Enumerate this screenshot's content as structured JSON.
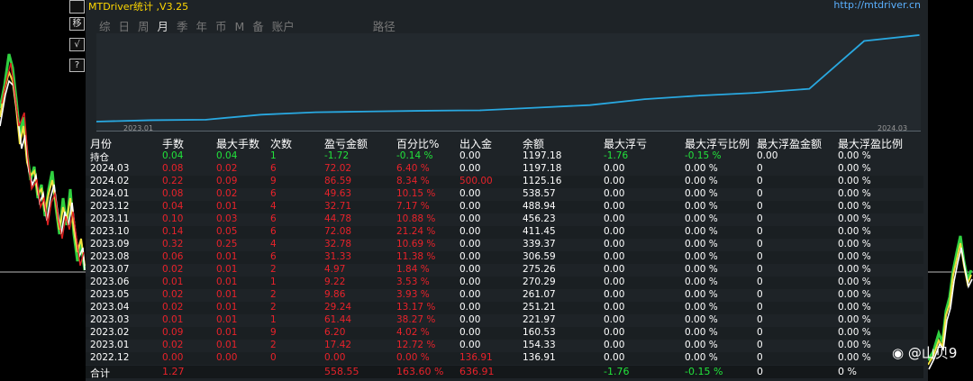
{
  "app": {
    "title": "MTDriver统计 ,V3.25",
    "url": "http://mtdriver.cn"
  },
  "side_buttons": [
    "移",
    "√",
    "?"
  ],
  "tabs": [
    {
      "label": "综",
      "active": false
    },
    {
      "label": "日",
      "active": false
    },
    {
      "label": "周",
      "active": false
    },
    {
      "label": "月",
      "active": true
    },
    {
      "label": "季",
      "active": false
    },
    {
      "label": "年",
      "active": false
    },
    {
      "label": "币",
      "active": false
    },
    {
      "label": "M",
      "active": false
    },
    {
      "label": "备",
      "active": false
    },
    {
      "label": "账户",
      "active": false
    }
  ],
  "path_label": "路径",
  "equity_chart": {
    "start_label": "2023.01",
    "end_label": "2024.03",
    "line_color": "#29a8e0",
    "balances": [
      136.91,
      154.33,
      160.53,
      221.97,
      251.21,
      261.07,
      270.29,
      275.26,
      306.59,
      339.37,
      411.45,
      456.23,
      488.94,
      538.57,
      1125.16,
      1197.18
    ]
  },
  "columns": [
    "月份",
    "手数",
    "最大手数",
    "次数",
    "盈亏金额",
    "百分比%",
    "出入金",
    "余额",
    "最大浮亏",
    "最大浮亏比例",
    "最大浮盈金额",
    "最大浮盈比例"
  ],
  "holding": [
    "持仓",
    "0.04",
    "0.04",
    "1",
    "-1.72",
    "-0.14 %",
    "0.00",
    "1197.18",
    "-1.76",
    "-0.15 %",
    "0.00",
    "0.00 %"
  ],
  "rows": [
    [
      "2024.03",
      "0.08",
      "0.02",
      "6",
      "72.02",
      "6.40 %",
      "0.00",
      "1197.18",
      "0.00",
      "0.00 %",
      "0",
      "0.00 %"
    ],
    [
      "2024.02",
      "0.22",
      "0.09",
      "9",
      "86.59",
      "8.34 %",
      "500.00",
      "1125.16",
      "0.00",
      "0.00 %",
      "0",
      "0.00 %"
    ],
    [
      "2024.01",
      "0.08",
      "0.02",
      "6",
      "49.63",
      "10.15 %",
      "0.00",
      "538.57",
      "0.00",
      "0.00 %",
      "0",
      "0.00 %"
    ],
    [
      "2023.12",
      "0.04",
      "0.01",
      "4",
      "32.71",
      "7.17 %",
      "0.00",
      "488.94",
      "0.00",
      "0.00 %",
      "0",
      "0.00 %"
    ],
    [
      "2023.11",
      "0.10",
      "0.03",
      "6",
      "44.78",
      "10.88 %",
      "0.00",
      "456.23",
      "0.00",
      "0.00 %",
      "0",
      "0.00 %"
    ],
    [
      "2023.10",
      "0.14",
      "0.05",
      "6",
      "72.08",
      "21.24 %",
      "0.00",
      "411.45",
      "0.00",
      "0.00 %",
      "0",
      "0.00 %"
    ],
    [
      "2023.09",
      "0.32",
      "0.25",
      "4",
      "32.78",
      "10.69 %",
      "0.00",
      "339.37",
      "0.00",
      "0.00 %",
      "0",
      "0.00 %"
    ],
    [
      "2023.08",
      "0.06",
      "0.01",
      "6",
      "31.33",
      "11.38 %",
      "0.00",
      "306.59",
      "0.00",
      "0.00 %",
      "0",
      "0.00 %"
    ],
    [
      "2023.07",
      "0.02",
      "0.01",
      "2",
      "4.97",
      "1.84 %",
      "0.00",
      "275.26",
      "0.00",
      "0.00 %",
      "0",
      "0.00 %"
    ],
    [
      "2023.06",
      "0.01",
      "0.01",
      "1",
      "9.22",
      "3.53 %",
      "0.00",
      "270.29",
      "0.00",
      "0.00 %",
      "0",
      "0.00 %"
    ],
    [
      "2023.05",
      "0.02",
      "0.01",
      "2",
      "9.86",
      "3.93 %",
      "0.00",
      "261.07",
      "0.00",
      "0.00 %",
      "0",
      "0.00 %"
    ],
    [
      "2023.04",
      "0.02",
      "0.01",
      "2",
      "29.24",
      "13.17 %",
      "0.00",
      "251.21",
      "0.00",
      "0.00 %",
      "0",
      "0.00 %"
    ],
    [
      "2023.03",
      "0.01",
      "0.01",
      "1",
      "61.44",
      "38.27 %",
      "0.00",
      "221.97",
      "0.00",
      "0.00 %",
      "0",
      "0.00 %"
    ],
    [
      "2023.02",
      "0.09",
      "0.01",
      "9",
      "6.20",
      "4.02 %",
      "0.00",
      "160.53",
      "0.00",
      "0.00 %",
      "0",
      "0.00 %"
    ],
    [
      "2023.01",
      "0.02",
      "0.01",
      "2",
      "17.42",
      "12.72 %",
      "0.00",
      "154.33",
      "0.00",
      "0.00 %",
      "0",
      "0.00 %"
    ],
    [
      "2022.12",
      "0.00",
      "0.00",
      "0",
      "0.00",
      "0.00 %",
      "136.91",
      "136.91",
      "0.00",
      "0.00 %",
      "0",
      "0.00 %"
    ]
  ],
  "total": [
    "合计",
    "1.27",
    "",
    "",
    "558.55",
    "163.60 %",
    "636.91",
    "",
    "-1.76",
    "-0.15 %",
    "0",
    "0 %"
  ],
  "colors": {
    "profit": "#e8222a",
    "loss_float": "#22e33b",
    "panel_bg": "#1e2327"
  },
  "watermark": "@山贝9"
}
